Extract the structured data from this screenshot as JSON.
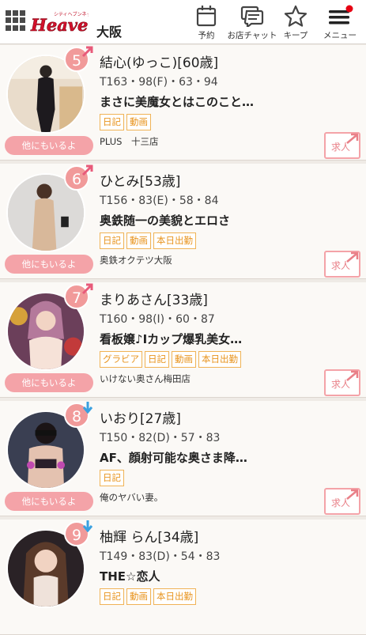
{
  "header": {
    "logo_text": "Heaven",
    "logo_sub": "シティヘブンネット",
    "area": "大阪",
    "buttons": [
      {
        "label": "予約",
        "icon": "calendar-icon"
      },
      {
        "label": "お店チャット",
        "icon": "chat-icon"
      },
      {
        "label": "キープ",
        "icon": "star-icon"
      },
      {
        "label": "メニュー",
        "icon": "hamburger-menu-icon"
      }
    ]
  },
  "colors": {
    "accent_pink": "#f19a9a",
    "tag_orange": "#e8941f",
    "notify_red": "#e60012"
  },
  "cards": [
    {
      "rank": "5",
      "trend": "up",
      "name": "結心(ゆっこ)[60歳]",
      "specs": "T163・98(F)・63・94",
      "catch": "まさに美魔女とはこのこと…",
      "tags": [
        "日記",
        "動画"
      ],
      "shop": "PLUS　十三店",
      "also_label": "他にもいるよ",
      "recruit_label": "求人"
    },
    {
      "rank": "6",
      "trend": "up",
      "name": "ひとみ[53歳]",
      "specs": "T156・83(E)・58・84",
      "catch": "奥鉄随一の美貌とエロさ",
      "tags": [
        "日記",
        "動画",
        "本日出勤"
      ],
      "shop": "奥鉄オクテツ大阪",
      "also_label": "他にもいるよ",
      "recruit_label": "求人"
    },
    {
      "rank": "7",
      "trend": "up",
      "name": "まりあさん[33歳]",
      "specs": "T160・98(I)・60・87",
      "catch": "看板嬢♪Iカップ爆乳美女…",
      "tags": [
        "グラビア",
        "日記",
        "動画",
        "本日出勤"
      ],
      "shop": "いけない奥さん梅田店",
      "also_label": "他にもいるよ",
      "recruit_label": "求人"
    },
    {
      "rank": "8",
      "trend": "down",
      "name": "いおり[27歳]",
      "specs": "T150・82(D)・57・83",
      "catch": "AF、顔射可能な奥さま降…",
      "tags": [
        "日記"
      ],
      "shop": "俺のヤバい妻。",
      "also_label": "他にもいるよ",
      "recruit_label": "求人"
    },
    {
      "rank": "9",
      "trend": "down",
      "name": "柚輝 らん[34歳]",
      "specs": "T149・83(D)・54・83",
      "catch": "THE☆恋人",
      "tags": [
        "日記",
        "動画",
        "本日出勤"
      ],
      "shop": "",
      "also_label": "",
      "recruit_label": ""
    }
  ]
}
